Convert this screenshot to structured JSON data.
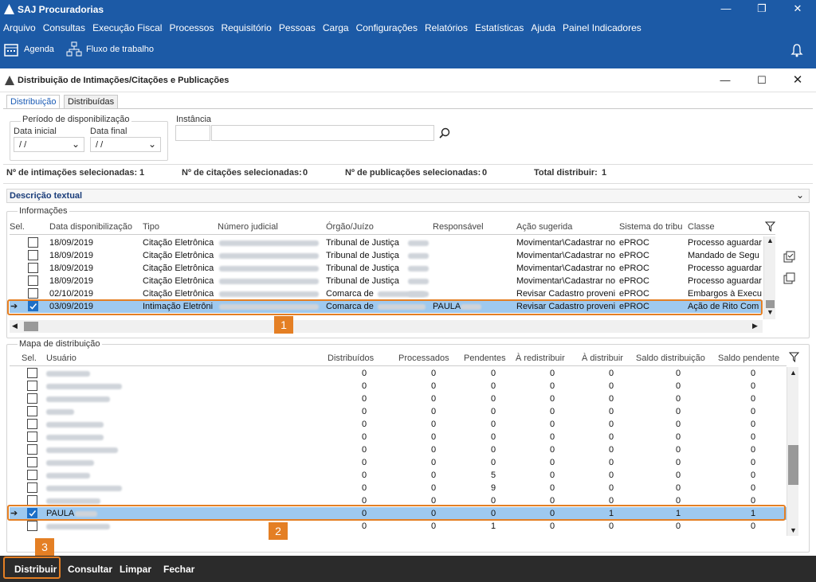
{
  "app": {
    "title": "SAJ Procuradorias"
  },
  "menu": [
    "Arquivo",
    "Consultas",
    "Execução Fiscal",
    "Processos",
    "Requisitório",
    "Pessoas",
    "Carga",
    "Configurações",
    "Relatórios",
    "Estatísticas",
    "Ajuda",
    "Painel Indicadores"
  ],
  "toolbar": {
    "agenda": "Agenda",
    "fluxo": "Fluxo de trabalho"
  },
  "window": {
    "title": "Distribuição de Intimações/Citações e Publicações"
  },
  "tabs": [
    "Distribuição",
    "Distribuídas"
  ],
  "filters": {
    "periodo_label": "Período de disponibilização",
    "data_inicial_label": "Data inicial",
    "data_final_label": "Data final",
    "data_inicial_value": " / /",
    "data_final_value": " / /",
    "instancia_label": "Instância"
  },
  "stats": {
    "intimacoes": "Nº de intimações selecionadas:",
    "intimacoes_val": "1",
    "citacoes": "Nº de citações selecionadas:",
    "citacoes_val": "0",
    "publicacoes": "Nº de publicações selecionadas:",
    "publicacoes_val": "0",
    "total": "Total distribuir:",
    "total_val": "1"
  },
  "descricao": "Descrição textual",
  "informacoes": {
    "label": "Informações",
    "columns": [
      "Sel.",
      "Data disponibilização",
      "Tipo",
      "Número judicial",
      "Órgão/Juízo",
      "Responsável",
      "Ação sugerida",
      "Sistema do tribu",
      "Classe"
    ],
    "rows": [
      {
        "data": "18/09/2019",
        "tipo": "Citação Eletrônica",
        "orgao": "Tribunal de Justiça",
        "resp": "",
        "acao": "Movimentar\\Cadastrar no",
        "sistema": "ePROC",
        "classe": "Processo aguardar",
        "sel": false
      },
      {
        "data": "18/09/2019",
        "tipo": "Citação Eletrônica",
        "orgao": "Tribunal de Justiça",
        "resp": "",
        "acao": "Movimentar\\Cadastrar no",
        "sistema": "ePROC",
        "classe": "Mandado de Segu",
        "sel": false
      },
      {
        "data": "18/09/2019",
        "tipo": "Citação Eletrônica",
        "orgao": "Tribunal de Justiça",
        "resp": "",
        "acao": "Movimentar\\Cadastrar no",
        "sistema": "ePROC",
        "classe": "Processo aguardar",
        "sel": false
      },
      {
        "data": "18/09/2019",
        "tipo": "Citação Eletrônica",
        "orgao": "Tribunal de Justiça",
        "resp": "",
        "acao": "Movimentar\\Cadastrar no",
        "sistema": "ePROC",
        "classe": "Processo aguardar",
        "sel": false
      },
      {
        "data": "02/10/2019",
        "tipo": "Citação Eletrônica",
        "orgao": "Comarca de",
        "resp": "",
        "acao": "Revisar Cadastro proveni",
        "sistema": "ePROC",
        "classe": "Embargos à Execu",
        "sel": false
      },
      {
        "data": "03/09/2019",
        "tipo": "Intimação Eletrôni",
        "orgao": "Comarca de",
        "resp": "PAULA",
        "acao": "Revisar Cadastro proveni",
        "sistema": "ePROC",
        "classe": "Ação de Rito Com",
        "sel": true
      }
    ]
  },
  "mapa": {
    "label": "Mapa de distribuição",
    "columns": [
      "Sel.",
      "Usuário",
      "Distribuídos",
      "Processados",
      "Pendentes",
      "À redistribuir",
      "À distribuir",
      "Saldo distribuição",
      "Saldo pendente"
    ],
    "rows": [
      {
        "user": "",
        "v": [
          "0",
          "0",
          "0",
          "0",
          "0",
          "0",
          "0"
        ],
        "sel": false
      },
      {
        "user": "",
        "v": [
          "0",
          "0",
          "0",
          "0",
          "0",
          "0",
          "0"
        ],
        "sel": false
      },
      {
        "user": "",
        "v": [
          "0",
          "0",
          "0",
          "0",
          "0",
          "0",
          "0"
        ],
        "sel": false
      },
      {
        "user": "",
        "v": [
          "0",
          "0",
          "0",
          "0",
          "0",
          "0",
          "0"
        ],
        "sel": false
      },
      {
        "user": "",
        "v": [
          "0",
          "0",
          "0",
          "0",
          "0",
          "0",
          "0"
        ],
        "sel": false
      },
      {
        "user": "",
        "v": [
          "0",
          "0",
          "0",
          "0",
          "0",
          "0",
          "0"
        ],
        "sel": false
      },
      {
        "user": "",
        "v": [
          "0",
          "0",
          "0",
          "0",
          "0",
          "0",
          "0"
        ],
        "sel": false
      },
      {
        "user": "",
        "v": [
          "0",
          "0",
          "0",
          "0",
          "0",
          "0",
          "0"
        ],
        "sel": false
      },
      {
        "user": "",
        "v": [
          "0",
          "0",
          "5",
          "0",
          "0",
          "0",
          "0"
        ],
        "sel": false
      },
      {
        "user": "",
        "v": [
          "0",
          "0",
          "9",
          "0",
          "0",
          "0",
          "0"
        ],
        "sel": false
      },
      {
        "user": "",
        "v": [
          "0",
          "0",
          "0",
          "0",
          "0",
          "0",
          "0"
        ],
        "sel": false
      },
      {
        "user": "PAULA",
        "v": [
          "0",
          "0",
          "0",
          "0",
          "1",
          "1",
          "1"
        ],
        "sel": true
      },
      {
        "user": "",
        "v": [
          "0",
          "0",
          "1",
          "0",
          "0",
          "0",
          "0"
        ],
        "sel": false
      }
    ]
  },
  "badges": [
    "1",
    "2",
    "3"
  ],
  "bottom": {
    "distribuir": "Distribuir",
    "consultar": "Consultar",
    "limpar": "Limpar",
    "fechar": "Fechar"
  }
}
